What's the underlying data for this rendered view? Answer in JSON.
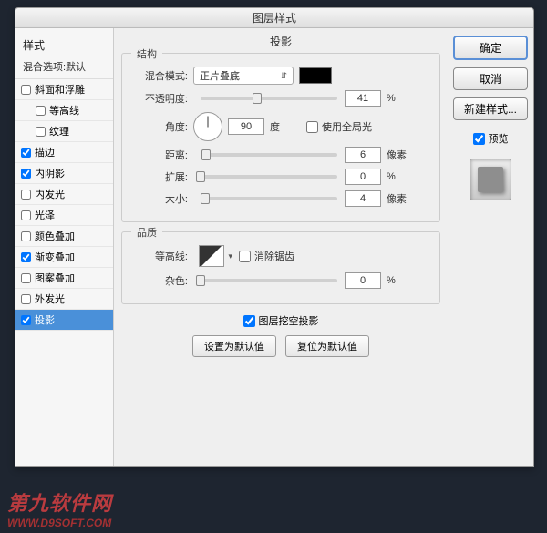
{
  "dialog": {
    "title": "图层样式"
  },
  "sidebar": {
    "heading": "样式",
    "subheading": "混合选项:默认",
    "items": [
      {
        "label": "斜面和浮雕",
        "checked": false,
        "indent": false
      },
      {
        "label": "等高线",
        "checked": false,
        "indent": true
      },
      {
        "label": "纹理",
        "checked": false,
        "indent": true
      },
      {
        "label": "描边",
        "checked": true,
        "indent": false
      },
      {
        "label": "内阴影",
        "checked": true,
        "indent": false
      },
      {
        "label": "内发光",
        "checked": false,
        "indent": false
      },
      {
        "label": "光泽",
        "checked": false,
        "indent": false
      },
      {
        "label": "颜色叠加",
        "checked": false,
        "indent": false
      },
      {
        "label": "渐变叠加",
        "checked": true,
        "indent": false
      },
      {
        "label": "图案叠加",
        "checked": false,
        "indent": false
      },
      {
        "label": "外发光",
        "checked": false,
        "indent": false
      },
      {
        "label": "投影",
        "checked": true,
        "indent": false,
        "active": true
      }
    ]
  },
  "main": {
    "tab": "投影",
    "structure": {
      "title": "结构",
      "blend_label": "混合模式:",
      "blend_value": "正片叠底",
      "opacity_label": "不透明度:",
      "opacity_value": "41",
      "opacity_unit": "%",
      "angle_label": "角度:",
      "angle_value": "90",
      "angle_unit": "度",
      "global_light": "使用全局光",
      "distance_label": "距离:",
      "distance_value": "6",
      "distance_unit": "像素",
      "spread_label": "扩展:",
      "spread_value": "0",
      "spread_unit": "%",
      "size_label": "大小:",
      "size_value": "4",
      "size_unit": "像素"
    },
    "quality": {
      "title": "品质",
      "contour_label": "等高线:",
      "antialias": "消除锯齿",
      "noise_label": "杂色:",
      "noise_value": "0",
      "noise_unit": "%"
    },
    "knockout": "图层挖空投影",
    "set_default": "设置为默认值",
    "reset_default": "复位为默认值"
  },
  "right": {
    "ok": "确定",
    "cancel": "取消",
    "new_style": "新建样式...",
    "preview": "预览"
  },
  "watermark": {
    "main": "第九软件网",
    "sub": "WWW.D9SOFT.COM"
  }
}
